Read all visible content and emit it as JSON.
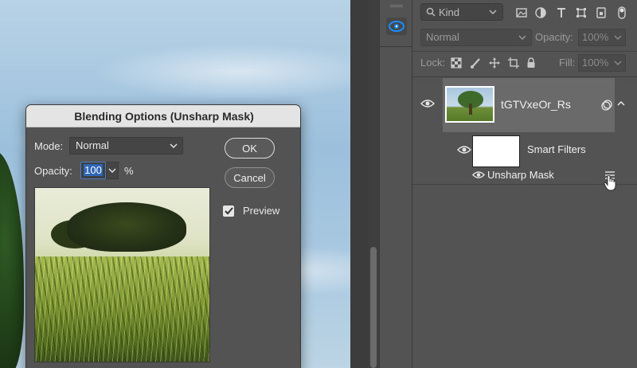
{
  "layers_panel": {
    "filter": {
      "kind_label": "Kind",
      "icons": [
        "pixel-filter-icon",
        "adjustment-filter-icon",
        "type-filter-icon",
        "shape-filter-icon",
        "smart-object-filter-icon",
        "filter-toggle-icon"
      ]
    },
    "blend_mode": "Normal",
    "opacity_label": "Opacity:",
    "opacity_value": "100%",
    "lock_label": "Lock:",
    "lock_icons": [
      "lock-transparent-pixels-icon",
      "lock-image-pixels-icon",
      "lock-position-icon",
      "lock-artboard-icon",
      "lock-all-icon"
    ],
    "fill_label": "Fill:",
    "fill_value": "100%",
    "layer": {
      "name": "tGTVxeOr_Rs",
      "smart_filters_label": "Smart Filters",
      "filter_name": "Unsharp Mask"
    }
  },
  "dialog": {
    "title": "Blending Options (Unsharp Mask)",
    "mode_label": "Mode:",
    "mode_value": "Normal",
    "opacity_label": "Opacity:",
    "opacity_value": "100",
    "opacity_unit": "%",
    "ok_label": "OK",
    "cancel_label": "Cancel",
    "preview_label": "Preview",
    "preview_checked": true
  },
  "colors": {
    "panel_bg": "#535353",
    "dialog_titlebar": "#e4e4e4",
    "selection_blue": "#2f66b5",
    "accent_blue": "#1a8cff"
  }
}
